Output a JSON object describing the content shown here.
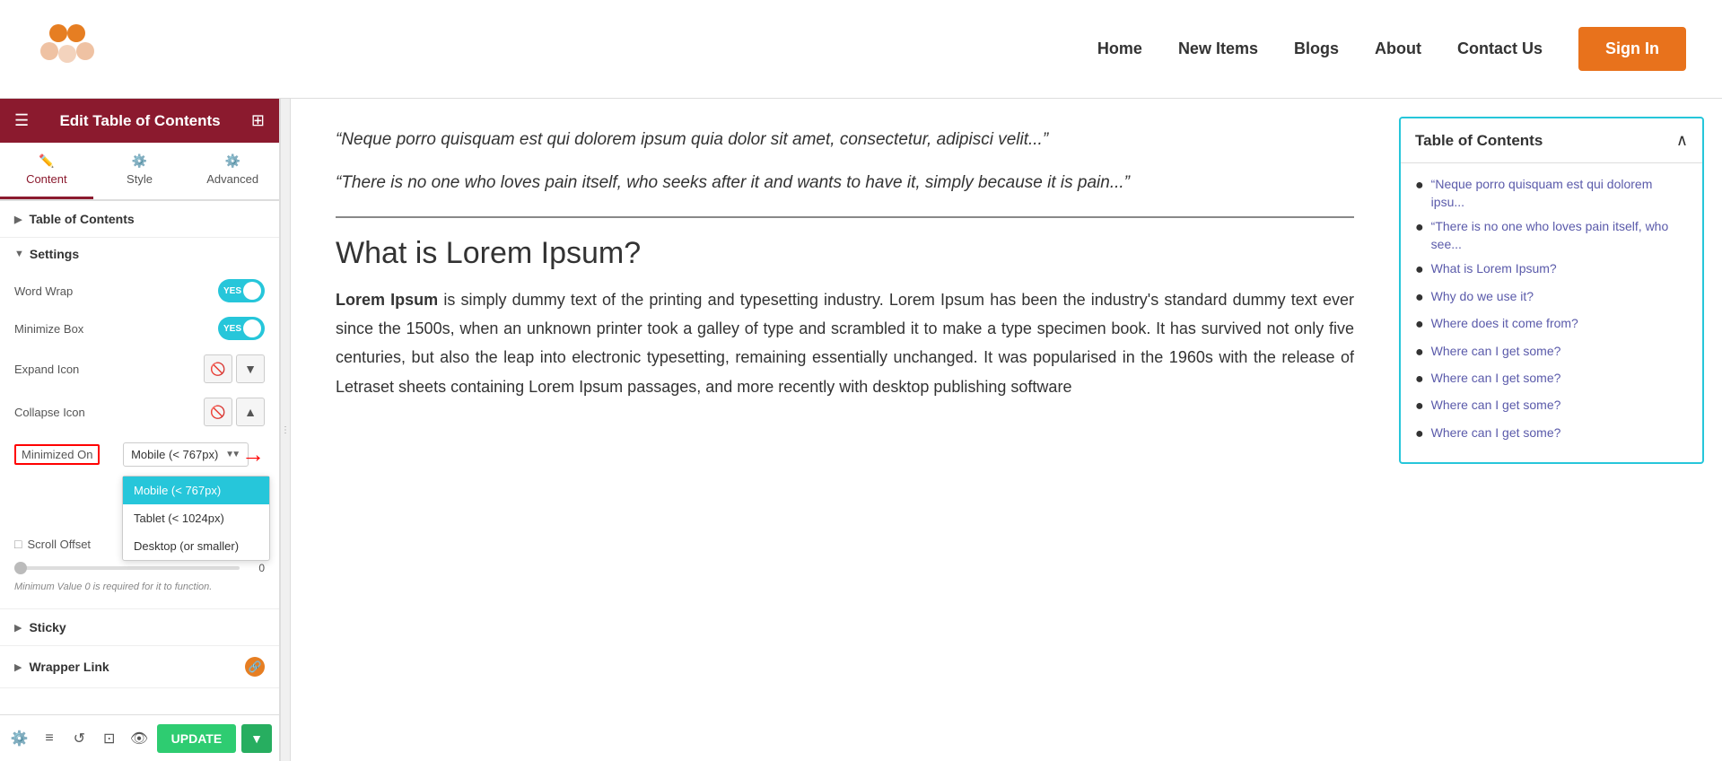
{
  "header": {
    "title": "Edit Table of Contents",
    "nav": {
      "home": "Home",
      "new_items": "New Items",
      "blogs": "Blogs",
      "about": "About",
      "contact": "Contact Us",
      "sign_in": "Sign In"
    }
  },
  "panel": {
    "title": "Edit Table of Contents",
    "tabs": [
      {
        "label": "Content",
        "icon": "✏️"
      },
      {
        "label": "Style",
        "icon": "⚙️"
      },
      {
        "label": "Advanced",
        "icon": "⚙️"
      }
    ],
    "sections": {
      "table_of_contents": "Table of Contents",
      "settings": "Settings",
      "sticky": "Sticky",
      "wrapper_link": "Wrapper Link"
    },
    "settings": {
      "word_wrap": "Word Wrap",
      "minimize_box": "Minimize Box",
      "expand_icon": "Expand Icon",
      "collapse_icon": "Collapse Icon",
      "minimized_on": "Minimized On",
      "scroll_offset": "Scroll Offset",
      "scroll_value": "0",
      "hint": "Minimum Value 0 is required for it to function."
    },
    "minimized_dropdown": {
      "selected": "Mobile (< 767px)",
      "options": [
        "Mobile (< 767px)",
        "Tablet (< 1024px)",
        "Desktop (or smaller)"
      ]
    },
    "toolbar": {
      "update": "UPDATE"
    }
  },
  "content": {
    "quote1": "“Neque porro quisquam est qui dolorem ipsum quia dolor sit amet, consectetur, adipisci velit...”",
    "quote2": "“There is no one who loves pain itself, who seeks after it and wants to have it, simply because it is pain...”",
    "heading": "What is Lorem Ipsum?",
    "body": "Lorem Ipsum is simply dummy text of the printing and typesetting industry. Lorem Ipsum has been the industry’s standard dummy text ever since the 1500s, when an unknown printer took a galley of type and scrambled it to make a type specimen book. It has survived not only five centuries, but also the leap into electronic typesetting, remaining essentially unchanged. It was popularised in the 1960s with the release of Letraset sheets containing Lorem Ipsum passages, and more recently with desktop publishing software",
    "bold_start": "Lorem Ipsum"
  },
  "toc_widget": {
    "title": "Table of Contents",
    "items": [
      "“Neque porro quisquam est qui dolorem ipsu...",
      "“There is no one who loves pain itself, who see...",
      "What is Lorem Ipsum?",
      "Why do we use it?",
      "Where does it come from?",
      "Where can I get some?",
      "Where can I get some?",
      "Where can I get some?",
      "Where can I get some?"
    ]
  }
}
